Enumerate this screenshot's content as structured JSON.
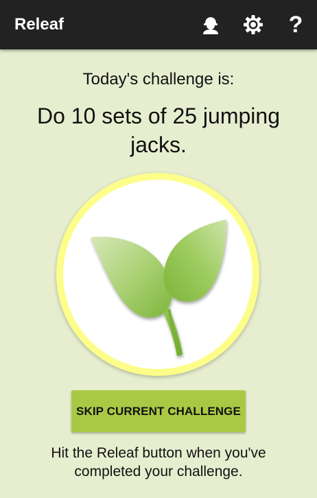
{
  "app_bar": {
    "title": "Releaf",
    "background": "#222222",
    "icons": [
      {
        "name": "profile-icon",
        "label": "profile"
      },
      {
        "name": "gear-icon",
        "label": "settings"
      },
      {
        "name": "help-icon",
        "label": "?"
      }
    ]
  },
  "main": {
    "intro": "Today's challenge is:",
    "challenge": "Do 10 sets of 25 jumping jacks.",
    "leaf_button_icon": "leaf-icon",
    "skip_button": "SKIP CURRENT CHALLENGE",
    "hint": "Hit the Releaf button when you've completed your challenge."
  },
  "colors": {
    "background": "#e6eecf",
    "ring": "#fdfd8a",
    "button": "#a9c944",
    "leaf": "#8dc24a"
  }
}
